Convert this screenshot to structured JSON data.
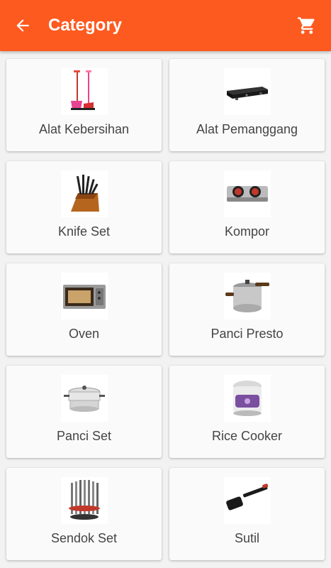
{
  "appbar": {
    "title": "Category",
    "back_icon": "arrow-back-icon",
    "cart_icon": "shopping-cart-icon",
    "color": "#fd5a1f"
  },
  "categories": [
    {
      "label": "Alat Kebersihan",
      "icon": "cleaning-tools-image"
    },
    {
      "label": "Alat Pemanggang",
      "icon": "grill-image"
    },
    {
      "label": "Knife Set",
      "icon": "knife-set-image"
    },
    {
      "label": "Kompor",
      "icon": "stove-image"
    },
    {
      "label": "Oven",
      "icon": "oven-image"
    },
    {
      "label": "Panci Presto",
      "icon": "pressure-cooker-image"
    },
    {
      "label": "Panci Set",
      "icon": "pot-set-image"
    },
    {
      "label": "Rice Cooker",
      "icon": "rice-cooker-image"
    },
    {
      "label": "Sendok Set",
      "icon": "spoon-set-image"
    },
    {
      "label": "Sutil",
      "icon": "spatula-image"
    }
  ]
}
